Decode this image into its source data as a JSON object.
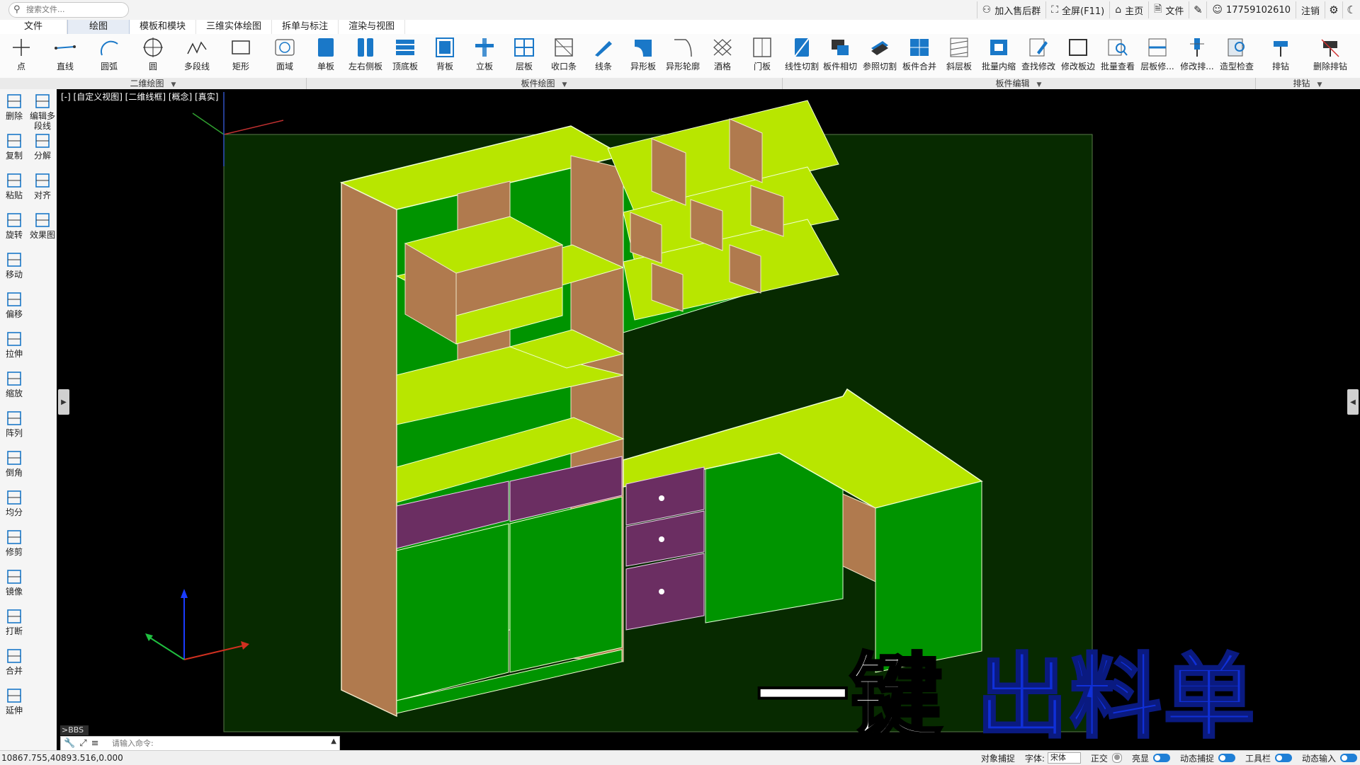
{
  "topbar": {
    "search_placeholder": "搜索文件...",
    "buttons": [
      {
        "label": "加入售后群",
        "icon": "user-group-icon"
      },
      {
        "label": "全屏(F11)",
        "icon": "fullscreen-icon"
      },
      {
        "label": "主页",
        "icon": "home-icon"
      },
      {
        "label": "文件",
        "icon": "file-icon"
      }
    ],
    "user": "17759102610",
    "logout": "注销"
  },
  "menu": {
    "items": [
      "文件",
      "绘图",
      "模板和模块",
      "三维实体绘图",
      "拆单与标注",
      "渲染与视图"
    ],
    "active": "绘图"
  },
  "ribbon": {
    "tools": [
      {
        "label": "点",
        "icon": "point-icon"
      },
      {
        "label": "直线",
        "icon": "line-icon"
      },
      {
        "label": "圆弧",
        "icon": "arc-icon"
      },
      {
        "label": "圆",
        "icon": "circle-icon"
      },
      {
        "label": "多段线",
        "icon": "polyline-icon"
      },
      {
        "label": "矩形",
        "icon": "rectangle-icon"
      },
      {
        "label": "面域",
        "icon": "region-icon"
      },
      {
        "label": "单板",
        "icon": "single-panel-icon"
      },
      {
        "label": "左右侧板",
        "icon": "side-panels-icon"
      },
      {
        "label": "顶底板",
        "icon": "top-bottom-panel-icon"
      },
      {
        "label": "背板",
        "icon": "back-panel-icon"
      },
      {
        "label": "立板",
        "icon": "vertical-panel-icon"
      },
      {
        "label": "层板",
        "icon": "shelf-icon"
      },
      {
        "label": "收口条",
        "icon": "edge-strip-icon"
      },
      {
        "label": "线条",
        "icon": "molding-icon"
      },
      {
        "label": "异形板",
        "icon": "shaped-panel-icon"
      },
      {
        "label": "异形轮廓",
        "icon": "shaped-outline-icon"
      },
      {
        "label": "酒格",
        "icon": "wine-rack-icon"
      },
      {
        "label": "门板",
        "icon": "door-panel-icon"
      },
      {
        "label": "线性切割",
        "icon": "linear-cut-icon"
      },
      {
        "label": "板件相切",
        "icon": "panel-tangent-icon"
      },
      {
        "label": "参照切割",
        "icon": "reference-cut-icon"
      },
      {
        "label": "板件合并",
        "icon": "panel-merge-icon"
      },
      {
        "label": "斜层板",
        "icon": "slant-shelf-icon"
      },
      {
        "label": "批量内缩",
        "icon": "batch-inset-icon"
      },
      {
        "label": "查找修改",
        "icon": "find-modify-icon"
      },
      {
        "label": "修改板边",
        "icon": "modify-edge-icon"
      },
      {
        "label": "批量查看",
        "icon": "batch-view-icon"
      },
      {
        "label": "层板修...",
        "icon": "shelf-modify-icon"
      },
      {
        "label": "修改排...",
        "icon": "modify-drill-icon"
      },
      {
        "label": "造型检查",
        "icon": "model-check-icon"
      },
      {
        "label": "排钻",
        "icon": "drill-icon"
      },
      {
        "label": "删除排钻",
        "icon": "delete-drill-icon"
      }
    ],
    "groups": [
      {
        "label": "二维绘图"
      },
      {
        "label": "板件绘图"
      },
      {
        "label": "板件编辑"
      },
      {
        "label": "排钻"
      }
    ]
  },
  "left_tools": [
    {
      "label": "删除",
      "icon": "delete-icon"
    },
    {
      "label": "编辑多段线",
      "icon": "edit-polyline-icon"
    },
    {
      "label": "复制",
      "icon": "copy-icon"
    },
    {
      "label": "分解",
      "icon": "explode-icon"
    },
    {
      "label": "粘贴",
      "icon": "paste-icon"
    },
    {
      "label": "对齐",
      "icon": "align-icon"
    },
    {
      "label": "旋转",
      "icon": "rotate-icon"
    },
    {
      "label": "效果图",
      "icon": "render-icon"
    },
    {
      "label": "移动",
      "icon": "move-icon"
    },
    {
      "label": "偏移",
      "icon": "offset-icon"
    },
    {
      "label": "拉伸",
      "icon": "stretch-icon"
    },
    {
      "label": "缩放",
      "icon": "scale-icon"
    },
    {
      "label": "阵列",
      "icon": "array-icon"
    },
    {
      "label": "倒角",
      "icon": "chamfer-icon"
    },
    {
      "label": "均分",
      "icon": "divide-icon"
    },
    {
      "label": "修剪",
      "icon": "trim-icon"
    },
    {
      "label": "镜像",
      "icon": "mirror-icon"
    },
    {
      "label": "打断",
      "icon": "break-icon"
    },
    {
      "label": "合并",
      "icon": "join-icon"
    },
    {
      "label": "延伸",
      "icon": "extend-icon"
    }
  ],
  "viewport": {
    "label": "[-] [自定义视图] [二维线框] [概念] [真实]",
    "overlay_white": "一键",
    "overlay_blue": "出料单"
  },
  "command": {
    "tag": ">BBS",
    "placeholder": "请输入命令:"
  },
  "status": {
    "coords": "10867.755,40893.516,0.000",
    "snap": "对象捕捉",
    "font_label": "字体:",
    "font_value": "宋体",
    "ortho": "正交",
    "highlight": "亮显",
    "dynamic_snap": "动态捕捉",
    "toolbar": "工具栏",
    "dynamic_input": "动态输入"
  },
  "colors": {
    "panel_lime": "#b8e600",
    "panel_green": "#009400",
    "panel_wood": "#b07a4e",
    "panel_purple": "#6b2e62",
    "overlay_blue": "#1030d8"
  }
}
